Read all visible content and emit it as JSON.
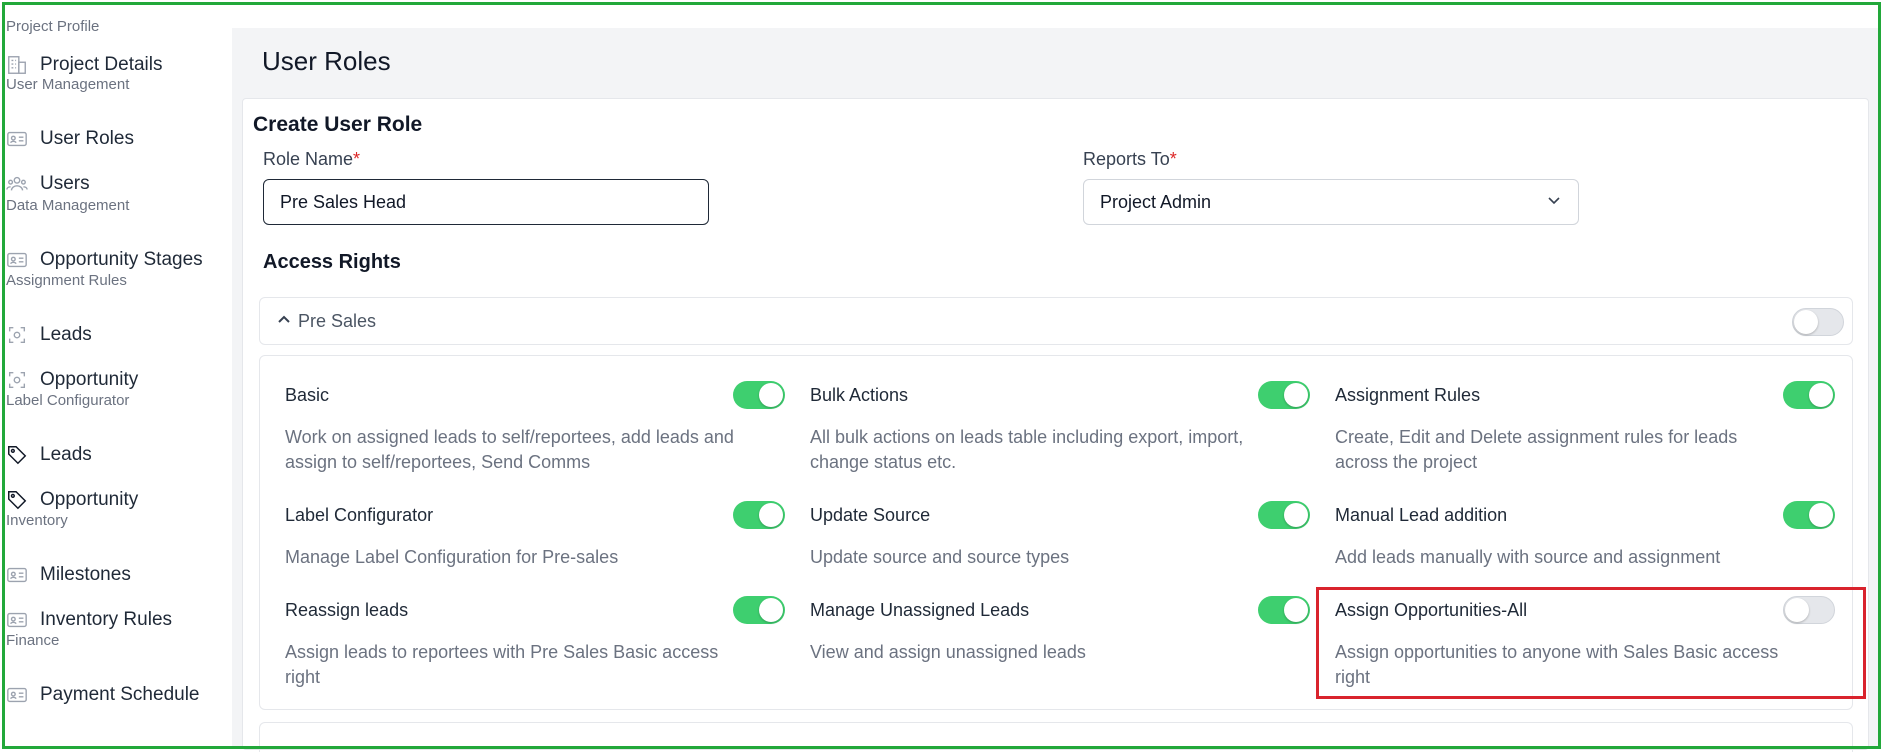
{
  "sidebar": {
    "sections": [
      {
        "title": "Project Profile",
        "items": [
          {
            "label": "Project Details",
            "icon": "building-icon"
          }
        ]
      },
      {
        "title": "User Management",
        "items": [
          {
            "label": "User Roles",
            "icon": "id-card-icon"
          },
          {
            "label": "Users",
            "icon": "users-icon"
          }
        ]
      },
      {
        "title": "Data Management",
        "items": [
          {
            "label": "Opportunity Stages",
            "icon": "id-card-icon"
          }
        ]
      },
      {
        "title": "Assignment Rules",
        "items": [
          {
            "label": "Leads",
            "icon": "focus-icon"
          },
          {
            "label": "Opportunity",
            "icon": "focus-icon"
          }
        ]
      },
      {
        "title": "Label Configurator",
        "items": [
          {
            "label": "Leads",
            "icon": "tag-icon"
          },
          {
            "label": "Opportunity",
            "icon": "tag-icon"
          }
        ]
      },
      {
        "title": "Inventory",
        "items": [
          {
            "label": "Milestones",
            "icon": "id-card-icon"
          },
          {
            "label": "Inventory Rules",
            "icon": "id-card-icon"
          }
        ]
      },
      {
        "title": "Finance",
        "items": [
          {
            "label": "Payment Schedule",
            "icon": "id-card-icon"
          }
        ]
      }
    ]
  },
  "page": {
    "title": "User Roles"
  },
  "form": {
    "title": "Create User Role",
    "role_name_label": "Role Name",
    "role_name_value": "Pre Sales Head",
    "reports_to_label": "Reports To",
    "reports_to_value": "Project Admin",
    "required_mark": "*"
  },
  "access": {
    "heading": "Access Rights",
    "group_label": "Pre Sales",
    "group_enabled": false,
    "permissions": [
      {
        "title": "Basic",
        "desc": "Work on assigned leads to self/reportees, add leads and assign to self/reportees, Send Comms",
        "enabled": true
      },
      {
        "title": "Bulk Actions",
        "desc": "All bulk actions on leads table including export, import, change status etc.",
        "enabled": true
      },
      {
        "title": "Assignment Rules",
        "desc": "Create, Edit and Delete assignment rules for leads across the project",
        "enabled": true
      },
      {
        "title": "Label Configurator",
        "desc": "Manage Label Configuration for Pre-sales",
        "enabled": true
      },
      {
        "title": "Update Source",
        "desc": "Update source and source types",
        "enabled": true
      },
      {
        "title": "Manual Lead addition",
        "desc": "Add leads manually with source and assignment",
        "enabled": true
      },
      {
        "title": "Reassign leads",
        "desc": "Assign leads to reportees with Pre Sales Basic access right",
        "enabled": true
      },
      {
        "title": "Manage Unassigned Leads",
        "desc": "View and assign unassigned leads",
        "enabled": true
      },
      {
        "title": "Assign Opportunities-All",
        "desc": "Assign opportunities to anyone with Sales Basic access right",
        "enabled": false
      }
    ]
  },
  "colors": {
    "toggle_on": "#3ecf6f",
    "toggle_off": "#e5e7eb",
    "highlight": "#d9232d",
    "frame": "#22a83a"
  }
}
